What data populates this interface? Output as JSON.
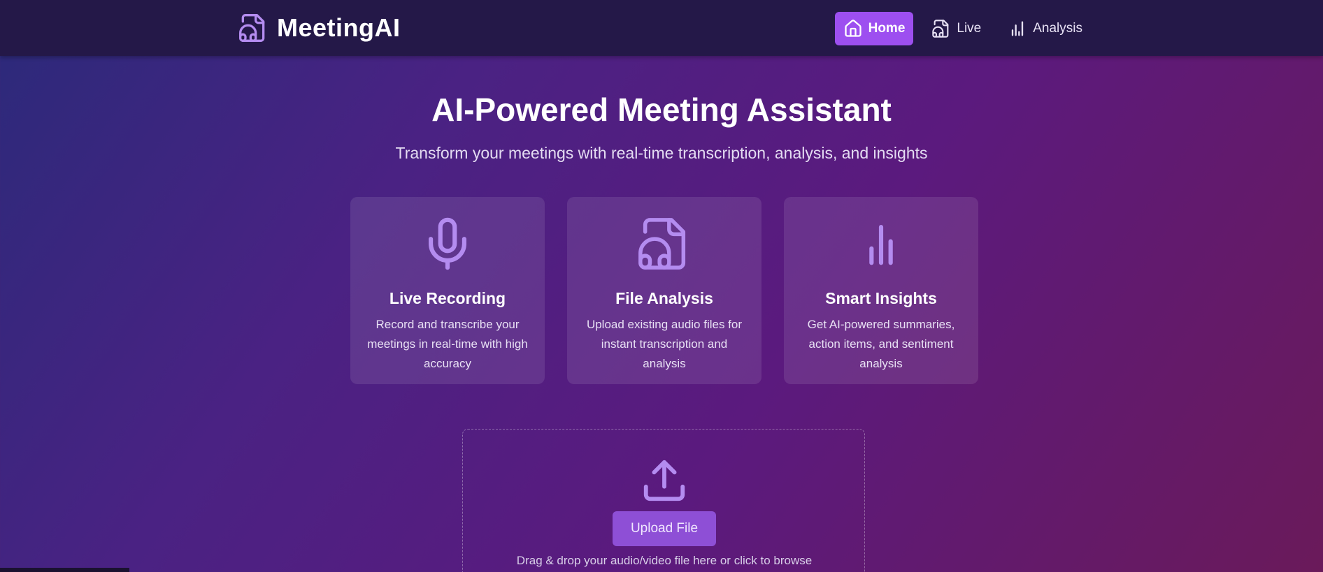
{
  "header": {
    "brand_icon": "headphones-file-icon",
    "brand_name": "MeetingAI",
    "nav": [
      {
        "label": "Home",
        "icon": "home-icon",
        "active": true
      },
      {
        "label": "Live",
        "icon": "headphones-icon",
        "active": false
      },
      {
        "label": "Analysis",
        "icon": "bar-chart-icon",
        "active": false
      }
    ]
  },
  "hero": {
    "title": "AI-Powered Meeting Assistant",
    "subtitle": "Transform your meetings with real-time transcription, analysis, and insights"
  },
  "features": [
    {
      "icon": "microphone-icon",
      "title": "Live Recording",
      "description": "Record and transcribe your meetings in real-time with high accuracy"
    },
    {
      "icon": "audio-file-icon",
      "title": "File Analysis",
      "description": "Upload existing audio files for instant transcription and analysis"
    },
    {
      "icon": "bar-chart-icon",
      "title": "Smart Insights",
      "description": "Get AI-powered summaries, action items, and sentiment analysis"
    }
  ],
  "upload": {
    "icon": "upload-icon",
    "button_label": "Upload File",
    "hint": "Drag & drop your audio/video file here or click to browse"
  },
  "colors": {
    "accent": "#9d4ff0",
    "navbar": "#241848",
    "icon": "#b48cf0"
  }
}
